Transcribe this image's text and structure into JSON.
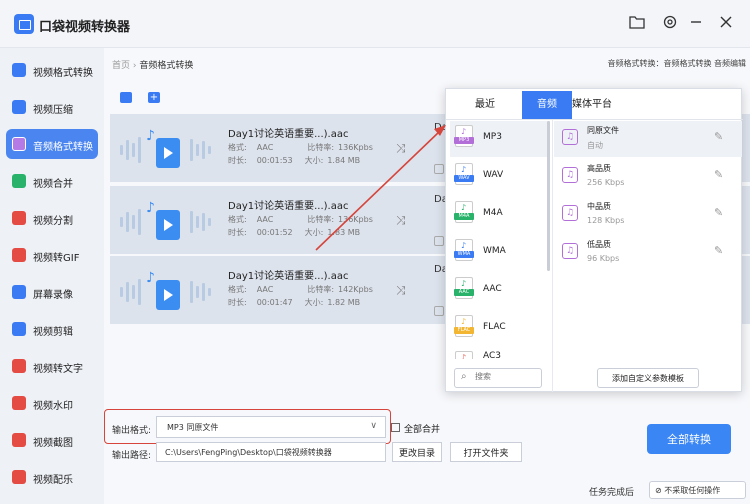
{
  "app": {
    "title": "口袋视频转换器"
  },
  "sidebar": {
    "items": [
      {
        "label": "视频格式转换",
        "color": "#3a7bf4"
      },
      {
        "label": "视频压缩",
        "color": "#3a7bf4"
      },
      {
        "label": "音频格式转换",
        "color": "#b47ae6",
        "active": true
      },
      {
        "label": "视频合并",
        "color": "#29b36a"
      },
      {
        "label": "视频分割",
        "color": "#e44b43"
      },
      {
        "label": "视频转GIF",
        "color": "#e44b43"
      },
      {
        "label": "屏幕录像",
        "color": "#3a7bf4"
      },
      {
        "label": "视频剪辑",
        "color": "#3a7bf4"
      },
      {
        "label": "视频转文字",
        "color": "#e44b43"
      },
      {
        "label": "视频水印",
        "color": "#e44b43"
      },
      {
        "label": "视频截图",
        "color": "#e44b43"
      },
      {
        "label": "视频配乐",
        "color": "#e44b43"
      }
    ]
  },
  "breadcrumb": {
    "home": "首页",
    "sep": "›",
    "current": "音频格式转换",
    "right": "音频格式转换：音频格式转换 音频编辑"
  },
  "files": [
    {
      "name": "Day1讨论英语重要...).aac",
      "fmt_label": "格式:",
      "fmt": "AAC",
      "rate_label": "比特率:",
      "rate": "136Kpbs",
      "dur_label": "时长:",
      "dur": "00:01:53",
      "size_label": "大小:",
      "size": "1.84 MB",
      "trail": "Day"
    },
    {
      "name": "Day1讨论英语重要...).aac",
      "fmt_label": "格式:",
      "fmt": "AAC",
      "rate_label": "比特率:",
      "rate": "136Kpbs",
      "dur_label": "时长:",
      "dur": "00:01:52",
      "size_label": "大小:",
      "size": "1.83 MB",
      "trail": "Day"
    },
    {
      "name": "Day1讨论英语重要...).aac",
      "fmt_label": "格式:",
      "fmt": "AAC",
      "rate_label": "比特率:",
      "rate": "142Kpbs",
      "dur_label": "时长:",
      "dur": "00:01:47",
      "size_label": "大小:",
      "size": "1.82 MB",
      "trail": "Day"
    }
  ],
  "popup": {
    "tabs": [
      "最近",
      "音频",
      "媒体平台"
    ],
    "formats": [
      {
        "label": "MP3",
        "color": "#b36fd8"
      },
      {
        "label": "WAV",
        "color": "#3a7bf4"
      },
      {
        "label": "M4A",
        "color": "#29b36a"
      },
      {
        "label": "WMA",
        "color": "#3a7bf4"
      },
      {
        "label": "AAC",
        "color": "#29b36a"
      },
      {
        "label": "FLAC",
        "color": "#f2b632"
      },
      {
        "label": "AC3",
        "color": "#e44b43"
      }
    ],
    "qualities": [
      {
        "name": "同原文件",
        "sub": "自动"
      },
      {
        "name": "高品质",
        "sub": "256 Kbps"
      },
      {
        "name": "中品质",
        "sub": "128 Kbps"
      },
      {
        "name": "低品质",
        "sub": "96 Kbps"
      }
    ],
    "search_placeholder": "搜索",
    "add_template": "添加自定义参数模板"
  },
  "output": {
    "format_label": "输出格式:",
    "format_value": "MP3   同原文件",
    "merge_label": "全部合并",
    "path_label": "输出路径:",
    "path_value": "C:\\Users\\FengPing\\Desktop\\口袋视频转换器",
    "change_dir": "更改目录",
    "open_folder": "打开文件夹",
    "convert_all": "全部转换"
  },
  "status": {
    "task_label": "任务完成后",
    "task_value": "⊘ 不采取任何操作"
  }
}
